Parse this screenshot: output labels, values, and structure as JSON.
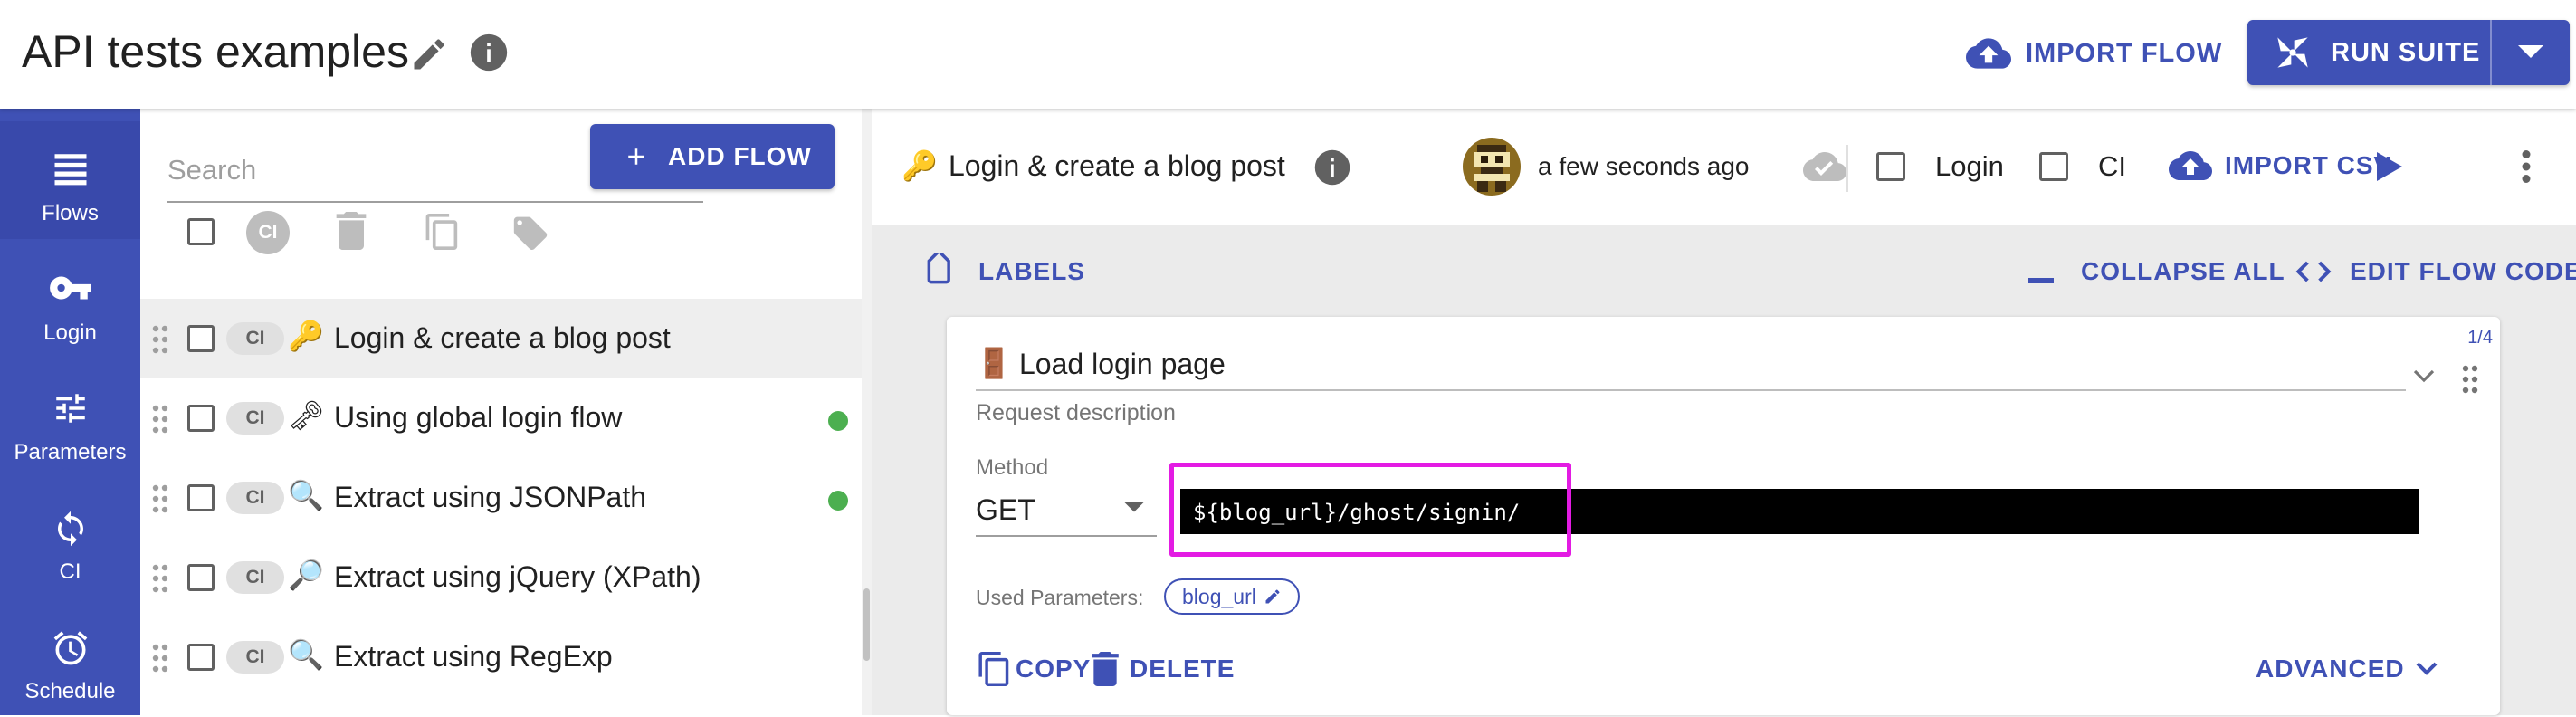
{
  "app": {
    "title": "API tests examples",
    "import_flow_label": "IMPORT FLOW",
    "run_suite_label": "RUN SUITE",
    "accent_color": "#3f51b5"
  },
  "nav": {
    "items": [
      {
        "label": "Flows",
        "icon": "list-icon",
        "active": true
      },
      {
        "label": "Login",
        "icon": "key-icon",
        "active": false
      },
      {
        "label": "Parameters",
        "icon": "tune-icon",
        "active": false
      },
      {
        "label": "CI",
        "icon": "sync-icon",
        "active": false
      },
      {
        "label": "Schedule",
        "icon": "alarm-icon",
        "active": false
      }
    ]
  },
  "flows_panel": {
    "search_placeholder": "Search",
    "add_flow_label": "ADD FLOW",
    "bulk_ci_label": "CI",
    "flows": [
      {
        "emoji": "🔑",
        "name": "Login & create a blog post",
        "ci": "CI",
        "selected": true,
        "status": ""
      },
      {
        "emoji": "🗝",
        "name": "Using global login flow",
        "ci": "CI",
        "selected": false,
        "status": "passed"
      },
      {
        "emoji": "🔍",
        "name": "Extract using JSONPath",
        "ci": "CI",
        "selected": false,
        "status": "passed"
      },
      {
        "emoji": "🔎",
        "name": "Extract using jQuery (XPath)",
        "ci": "CI",
        "selected": false,
        "status": ""
      },
      {
        "emoji": "🔍",
        "name": "Extract using RegExp",
        "ci": "CI",
        "selected": false,
        "status": ""
      }
    ]
  },
  "flow_header": {
    "emoji": "🔑",
    "title": "Login & create a blog post",
    "saved_time": "a few seconds ago",
    "login_label": "Login",
    "ci_label": "CI",
    "import_csv_label": "IMPORT CSV"
  },
  "toolbar": {
    "labels_label": "LABELS",
    "collapse_all_label": "COLLAPSE ALL",
    "edit_flow_code_label": "EDIT FLOW CODE"
  },
  "request": {
    "step_counter": "1/4",
    "emoji": "🚪",
    "name": "Load login page",
    "description_placeholder": "Request description",
    "method_label": "Method",
    "method_value": "GET",
    "url": "${blog_url}/ghost/signin/",
    "used_params_label": "Used Parameters:",
    "params": [
      "blog_url"
    ],
    "copy_label": "COPY",
    "delete_label": "DELETE",
    "advanced_label": "ADVANCED"
  }
}
